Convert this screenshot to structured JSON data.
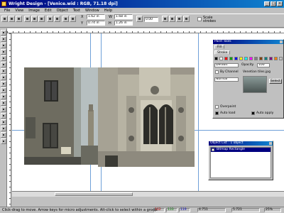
{
  "window": {
    "title": "Wright Design - [Venice.wid : RGB, 71.18 dpi]",
    "controls": [
      "_",
      "□",
      "×"
    ]
  },
  "menubar": {
    "items": [
      "File",
      "View",
      "Image",
      "Edit",
      "Object",
      "Text",
      "Window",
      "Help"
    ]
  },
  "toolbar": {
    "x_label": "X",
    "x_value": "1.62 in",
    "y_label": "Y",
    "y_value": "0.74 in",
    "w_label": "W",
    "w_value": "1.68 in",
    "h_label": "H",
    "h_value": "1.26 in",
    "angle_value": "0.00",
    "scale_strokes_label": "Scale strokes"
  },
  "panels": {
    "paint": {
      "title": "Paint Tools",
      "tabs": [
        "Fill",
        "Stroke"
      ],
      "mode_value": "Default",
      "opacity_label": "Opacity",
      "opacity_value": "100",
      "by_channel_label": "By Channel",
      "blend_value": "Normal",
      "texture_label": "Venetian tiles.jpg",
      "select_label": "Select",
      "overpaint_label": "Overpaint",
      "auto_load_label": "Auto load",
      "auto_apply_label": "Auto apply"
    },
    "objects": {
      "title": "Object List : 1 object",
      "items": [
        "Bitmap Rectangle"
      ]
    }
  },
  "statusbar": {
    "hint": "Click-drag to move. Arrow keys for micro adjustments. Alt-click to select within a group.",
    "rgb_r": "162",
    "rgb_g": "133",
    "rgb_b": "119",
    "x_value": "4.751",
    "y_value": "5.721",
    "zoom": "25%"
  },
  "colors": {
    "titlebar": "#000080",
    "selection": "#000080",
    "chrome": "#c0c0c0"
  }
}
